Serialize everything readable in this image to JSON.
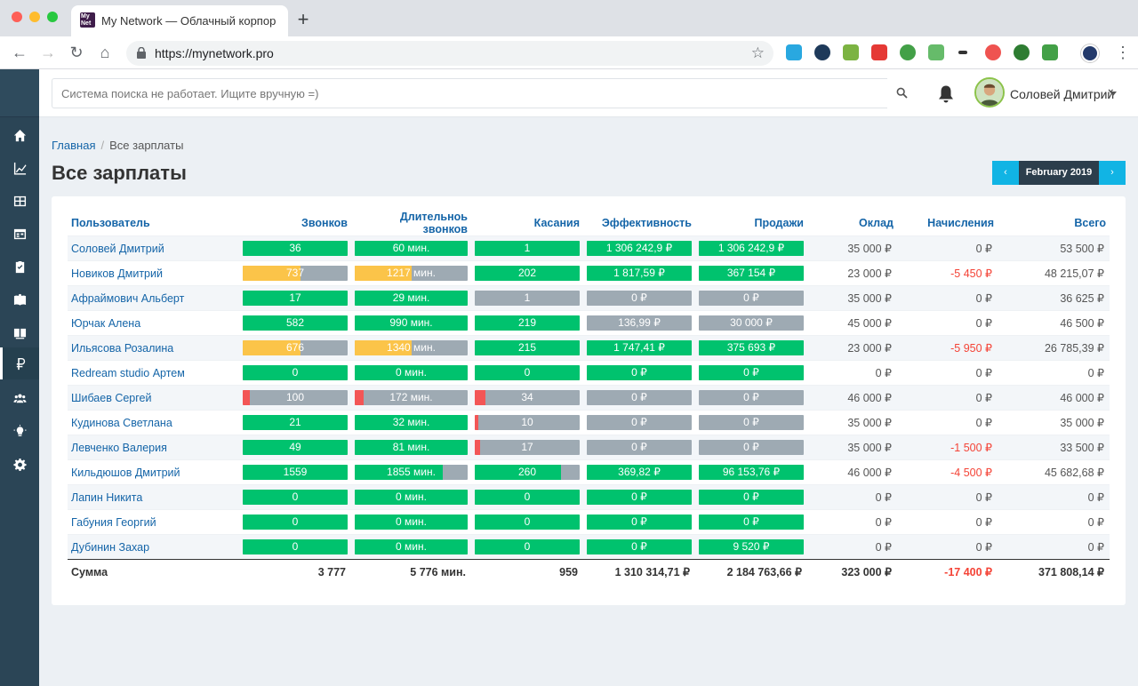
{
  "browser": {
    "tab_title": "My Network — Облачный корпоративный портал",
    "favicon_text": "My Net",
    "url": "https://mynetwork.pro"
  },
  "header": {
    "search_placeholder": "Система поиска не работает. Ищите вручную =)",
    "user_name": "Соловей Дмитрий"
  },
  "breadcrumb": {
    "home": "Главная",
    "current": "Все зарплаты"
  },
  "page_title": "Все зарплаты",
  "month_picker": {
    "prev": "‹",
    "label": "February 2019",
    "next": "›"
  },
  "colors": {
    "green": "#00c26e",
    "yellow": "#fbc449",
    "red": "#f35656",
    "gray": "#9eaab3",
    "accent": "#11b4e4",
    "link": "#1565a8"
  },
  "sidebar_icons": [
    "home-icon",
    "chart-icon",
    "grid-icon",
    "calendar-icon",
    "checklist-icon",
    "book-icon",
    "library-icon",
    "ruble-icon",
    "users-icon",
    "lightbulb-icon",
    "gear-icon"
  ],
  "table": {
    "columns": [
      "Пользователь",
      "Звонков",
      "Длительноь звонков",
      "Касания",
      "Эффективность",
      "Продажи",
      "Оклад",
      "Начисления",
      "Всего"
    ],
    "rows": [
      {
        "user": "Соловей Дмитрий",
        "calls": {
          "text": "36",
          "pct": 100,
          "tone": "ok"
        },
        "duration": {
          "text": "60 мин.",
          "pct": 100,
          "tone": "ok"
        },
        "touches": {
          "text": "1",
          "pct": 100,
          "tone": "ok"
        },
        "efficiency": {
          "text": "1 306 242,9 ₽",
          "pct": 100,
          "tone": "ok"
        },
        "sales": {
          "text": "1 306 242,9 ₽",
          "pct": 100,
          "tone": "ok"
        },
        "salary": "35 000 ₽",
        "accruals": "0 ₽",
        "accruals_neg": false,
        "total": "53 500 ₽"
      },
      {
        "user": "Новиков Дмитрий",
        "calls": {
          "text": "737",
          "pct": 55,
          "tone": "warn"
        },
        "duration": {
          "text": "1217 мин.",
          "pct": 50,
          "tone": "warn"
        },
        "touches": {
          "text": "202",
          "pct": 100,
          "tone": "ok"
        },
        "efficiency": {
          "text": "1 817,59 ₽",
          "pct": 100,
          "tone": "ok"
        },
        "sales": {
          "text": "367 154 ₽",
          "pct": 100,
          "tone": "ok"
        },
        "salary": "23 000 ₽",
        "accruals": "-5 450 ₽",
        "accruals_neg": true,
        "total": "48 215,07 ₽"
      },
      {
        "user": "Афраймович Альберт",
        "calls": {
          "text": "17",
          "pct": 100,
          "tone": "ok"
        },
        "duration": {
          "text": "29 мин.",
          "pct": 100,
          "tone": "ok"
        },
        "touches": {
          "text": "1",
          "pct": 0,
          "tone": "ok"
        },
        "efficiency": {
          "text": "0 ₽",
          "pct": 0,
          "tone": "ok"
        },
        "sales": {
          "text": "0 ₽",
          "pct": 0,
          "tone": "ok"
        },
        "salary": "35 000 ₽",
        "accruals": "0 ₽",
        "accruals_neg": false,
        "total": "36 625 ₽"
      },
      {
        "user": "Юрчак Алена",
        "calls": {
          "text": "582",
          "pct": 100,
          "tone": "ok"
        },
        "duration": {
          "text": "990 мин.",
          "pct": 100,
          "tone": "ok"
        },
        "touches": {
          "text": "219",
          "pct": 100,
          "tone": "ok"
        },
        "efficiency": {
          "text": "136,99 ₽",
          "pct": 0,
          "tone": "ok"
        },
        "sales": {
          "text": "30 000 ₽",
          "pct": 0,
          "tone": "ok"
        },
        "salary": "45 000 ₽",
        "accruals": "0 ₽",
        "accruals_neg": false,
        "total": "46 500 ₽"
      },
      {
        "user": "Ильясова Розалина",
        "calls": {
          "text": "676",
          "pct": 55,
          "tone": "warn"
        },
        "duration": {
          "text": "1340 мин.",
          "pct": 50,
          "tone": "warn"
        },
        "touches": {
          "text": "215",
          "pct": 100,
          "tone": "ok"
        },
        "efficiency": {
          "text": "1 747,41 ₽",
          "pct": 100,
          "tone": "ok"
        },
        "sales": {
          "text": "375 693 ₽",
          "pct": 100,
          "tone": "ok"
        },
        "salary": "23 000 ₽",
        "accruals": "-5 950 ₽",
        "accruals_neg": true,
        "total": "26 785,39 ₽"
      },
      {
        "user": "Redream studio Артем",
        "calls": {
          "text": "0",
          "pct": 100,
          "tone": "ok"
        },
        "duration": {
          "text": "0 мин.",
          "pct": 100,
          "tone": "ok"
        },
        "touches": {
          "text": "0",
          "pct": 100,
          "tone": "ok"
        },
        "efficiency": {
          "text": "0 ₽",
          "pct": 100,
          "tone": "ok"
        },
        "sales": {
          "text": "0 ₽",
          "pct": 100,
          "tone": "ok"
        },
        "salary": "0 ₽",
        "accruals": "0 ₽",
        "accruals_neg": false,
        "total": "0 ₽"
      },
      {
        "user": "Шибаев Сергей",
        "calls": {
          "text": "100",
          "pct": 7,
          "tone": "bad"
        },
        "duration": {
          "text": "172 мин.",
          "pct": 8,
          "tone": "bad"
        },
        "touches": {
          "text": "34",
          "pct": 10,
          "tone": "bad"
        },
        "efficiency": {
          "text": "0 ₽",
          "pct": 0,
          "tone": "ok"
        },
        "sales": {
          "text": "0 ₽",
          "pct": 0,
          "tone": "ok"
        },
        "salary": "46 000 ₽",
        "accruals": "0 ₽",
        "accruals_neg": false,
        "total": "46 000 ₽"
      },
      {
        "user": "Кудинова Светлана",
        "calls": {
          "text": "21",
          "pct": 100,
          "tone": "ok"
        },
        "duration": {
          "text": "32 мин.",
          "pct": 100,
          "tone": "ok"
        },
        "touches": {
          "text": "10",
          "pct": 3,
          "tone": "bad"
        },
        "efficiency": {
          "text": "0 ₽",
          "pct": 0,
          "tone": "ok"
        },
        "sales": {
          "text": "0 ₽",
          "pct": 0,
          "tone": "ok"
        },
        "salary": "35 000 ₽",
        "accruals": "0 ₽",
        "accruals_neg": false,
        "total": "35 000 ₽"
      },
      {
        "user": "Левченко Валерия",
        "calls": {
          "text": "49",
          "pct": 100,
          "tone": "ok"
        },
        "duration": {
          "text": "81 мин.",
          "pct": 100,
          "tone": "ok"
        },
        "touches": {
          "text": "17",
          "pct": 5,
          "tone": "bad"
        },
        "efficiency": {
          "text": "0 ₽",
          "pct": 0,
          "tone": "ok"
        },
        "sales": {
          "text": "0 ₽",
          "pct": 0,
          "tone": "ok"
        },
        "salary": "35 000 ₽",
        "accruals": "-1 500 ₽",
        "accruals_neg": true,
        "total": "33 500 ₽"
      },
      {
        "user": "Кильдюшов Дмитрий",
        "calls": {
          "text": "1559",
          "pct": 100,
          "tone": "ok"
        },
        "duration": {
          "text": "1855 мин.",
          "pct": 78,
          "tone": "ok"
        },
        "touches": {
          "text": "260",
          "pct": 82,
          "tone": "ok"
        },
        "efficiency": {
          "text": "369,82 ₽",
          "pct": 100,
          "tone": "ok"
        },
        "sales": {
          "text": "96 153,76 ₽",
          "pct": 100,
          "tone": "ok"
        },
        "salary": "46 000 ₽",
        "accruals": "-4 500 ₽",
        "accruals_neg": true,
        "total": "45 682,68 ₽"
      },
      {
        "user": "Лапин Никита",
        "calls": {
          "text": "0",
          "pct": 100,
          "tone": "ok"
        },
        "duration": {
          "text": "0 мин.",
          "pct": 100,
          "tone": "ok"
        },
        "touches": {
          "text": "0",
          "pct": 100,
          "tone": "ok"
        },
        "efficiency": {
          "text": "0 ₽",
          "pct": 100,
          "tone": "ok"
        },
        "sales": {
          "text": "0 ₽",
          "pct": 100,
          "tone": "ok"
        },
        "salary": "0 ₽",
        "accruals": "0 ₽",
        "accruals_neg": false,
        "total": "0 ₽"
      },
      {
        "user": "Габуния Георгий",
        "calls": {
          "text": "0",
          "pct": 100,
          "tone": "ok"
        },
        "duration": {
          "text": "0 мин.",
          "pct": 100,
          "tone": "ok"
        },
        "touches": {
          "text": "0",
          "pct": 100,
          "tone": "ok"
        },
        "efficiency": {
          "text": "0 ₽",
          "pct": 100,
          "tone": "ok"
        },
        "sales": {
          "text": "0 ₽",
          "pct": 100,
          "tone": "ok"
        },
        "salary": "0 ₽",
        "accruals": "0 ₽",
        "accruals_neg": false,
        "total": "0 ₽"
      },
      {
        "user": "Дубинин Захар",
        "calls": {
          "text": "0",
          "pct": 100,
          "tone": "ok"
        },
        "duration": {
          "text": "0 мин.",
          "pct": 100,
          "tone": "ok"
        },
        "touches": {
          "text": "0",
          "pct": 100,
          "tone": "ok"
        },
        "efficiency": {
          "text": "0 ₽",
          "pct": 100,
          "tone": "ok"
        },
        "sales": {
          "text": "9 520 ₽",
          "pct": 100,
          "tone": "ok"
        },
        "salary": "0 ₽",
        "accruals": "0 ₽",
        "accruals_neg": false,
        "total": "0 ₽"
      }
    ],
    "totals": {
      "label": "Сумма",
      "calls": "3 777",
      "duration": "5 776 мин.",
      "touches": "959",
      "efficiency": "1 310 314,71 ₽",
      "sales": "2 184 763,66 ₽",
      "salary": "323 000 ₽",
      "accruals": "-17 400 ₽",
      "total": "371 808,14 ₽"
    }
  }
}
